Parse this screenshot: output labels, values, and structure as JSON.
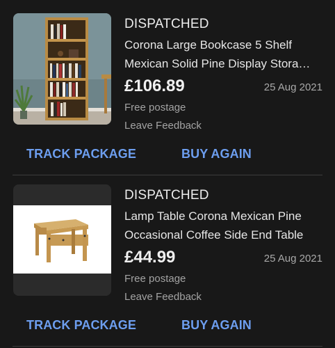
{
  "orders": [
    {
      "status": "DISPATCHED",
      "title_line1": "Corona Large Bookcase 5 Shelf",
      "title_line2": "Mexican Solid Pine Display Stora…",
      "price": "£106.89",
      "date": "25 Aug 2021",
      "postage": "Free postage",
      "feedback": "Leave Feedback",
      "track_label": "TRACK PACKAGE",
      "buy_again_label": "BUY AGAIN"
    },
    {
      "status": "DISPATCHED",
      "title_line1": "Lamp Table Corona Mexican Pine",
      "title_line2": "Occasional Coffee Side End Table",
      "price": "£44.99",
      "date": "25 Aug 2021",
      "postage": "Free postage",
      "feedback": "Leave Feedback",
      "track_label": "TRACK PACKAGE",
      "buy_again_label": "BUY AGAIN"
    }
  ],
  "colors": {
    "background": "#181818",
    "action_blue": "#6d9eef",
    "divider": "#3c3c3c"
  }
}
